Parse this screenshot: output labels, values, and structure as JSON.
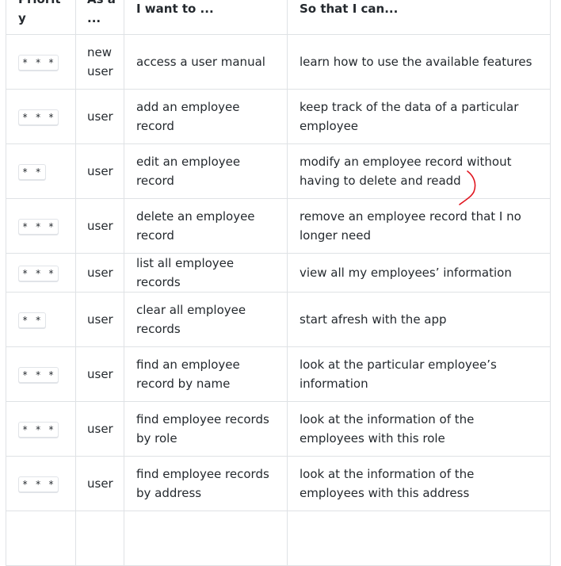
{
  "table": {
    "headers": {
      "priority": "Priority",
      "as_a": "As a ...",
      "i_want_to": "I want to ...",
      "so_that": "So that I can..."
    },
    "rows": [
      {
        "priority": "* * *",
        "role": "new user",
        "want": "access a user manual",
        "benefit": "learn how to use the available features"
      },
      {
        "priority": "* * *",
        "role": "user",
        "want": "add an employee record",
        "benefit": "keep track of the data of a particular employee"
      },
      {
        "priority": "* *",
        "role": "user",
        "want": "edit an employee record",
        "benefit": "modify an employee record without having to delete and readd"
      },
      {
        "priority": "* * *",
        "role": "user",
        "want": "delete an employee record",
        "benefit": "remove an employee record that I no longer need"
      },
      {
        "priority": "* * *",
        "role": "user",
        "want": "list all employee records",
        "benefit": "view all my employees’ information"
      },
      {
        "priority": "* *",
        "role": "user",
        "want": "clear all employee records",
        "benefit": "start afresh with the app"
      },
      {
        "priority": "* * *",
        "role": "user",
        "want": "find an employee record by name",
        "benefit": "look at the particular employee’s information"
      },
      {
        "priority": "* * *",
        "role": "user",
        "want": "find employee records by role",
        "benefit": "look at the information of the employees with this role"
      },
      {
        "priority": "* * *",
        "role": "user",
        "want": "find employee records by address",
        "benefit": "look at the information of the employees with this address"
      }
    ]
  },
  "annotation": {
    "color": "#e0141e"
  }
}
